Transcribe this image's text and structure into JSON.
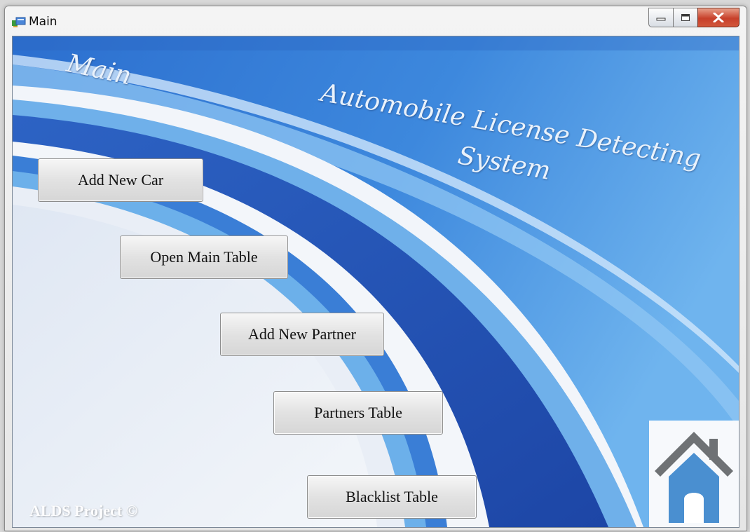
{
  "window": {
    "title": "Main",
    "icons": {
      "app": "window-app-icon",
      "minimize": "minimize-icon",
      "maximize": "maximize-icon",
      "close": "close-icon"
    }
  },
  "form": {
    "heading_main": "Main",
    "heading_system": "Automobile License Detecting System",
    "footer": "ALDS Project ©",
    "home_icon": "home-icon",
    "colors": {
      "sky_blue": "#3f86d8",
      "deep_blue": "#2250b0",
      "light_background": "#e9eef6"
    }
  },
  "buttons": {
    "add_new_car": "Add New Car",
    "open_main_table": "Open Main Table",
    "add_new_partner": "Add New Partner",
    "partners_table": "Partners Table",
    "blacklist_table": "Blacklist Table"
  }
}
